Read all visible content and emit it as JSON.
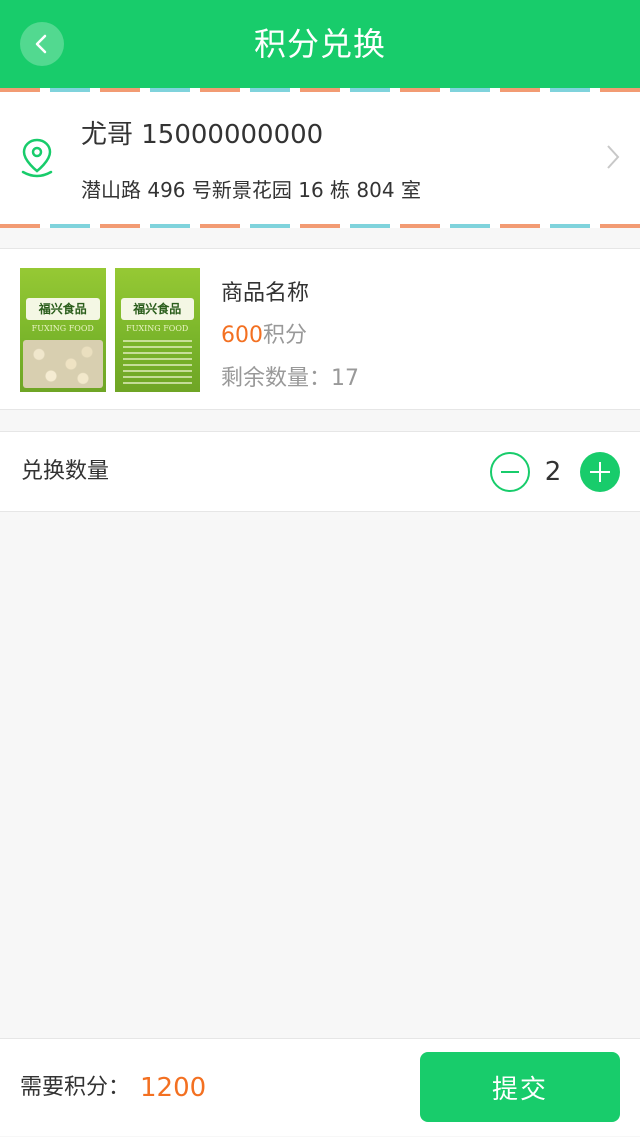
{
  "header": {
    "title": "积分兑换",
    "background": "#18cc6b"
  },
  "address": {
    "name_phone": "尤哥 15000000000",
    "address": "潜山路 496 号新景花园 16 栋 804 室"
  },
  "product": {
    "image_brand": "福兴食品",
    "image_brand_en": "FUXING FOOD",
    "name": "商品名称",
    "points_value": "600",
    "points_unit": "积分",
    "stock": "剩余数量：17"
  },
  "quantity": {
    "label": "兑换数量",
    "value": "2"
  },
  "footer": {
    "required_label": "需要积分：",
    "required_total": "1200",
    "submit_label": "提交"
  },
  "colors": {
    "accent": "#18cc6b",
    "highlight": "#f37021",
    "stripe_orange": "#f29b73",
    "stripe_teal": "#7fd3dc"
  },
  "icons": {
    "back": "chevron-left-icon",
    "location": "location-pin-icon",
    "forward": "chevron-right-icon",
    "minus": "minus-icon",
    "plus": "plus-icon"
  }
}
